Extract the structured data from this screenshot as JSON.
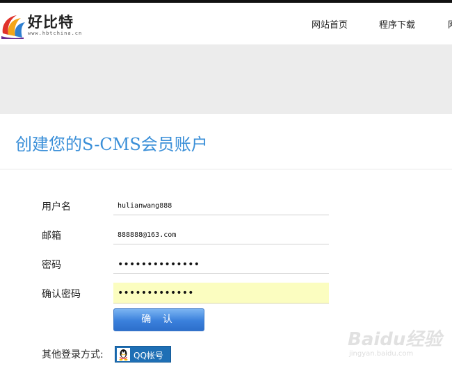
{
  "header": {
    "logo_title": "好比特",
    "logo_url": "www.hbtchina.cn",
    "nav": [
      "网站首页",
      "程序下载",
      "网"
    ]
  },
  "page": {
    "title": "创建您的S-CMS会员账户"
  },
  "form": {
    "username": {
      "label": "用户名",
      "value": "hulianwang888"
    },
    "email": {
      "label": "邮箱",
      "value": "888888@163.com"
    },
    "password": {
      "label": "密码",
      "value": "••••••••••••••"
    },
    "confirm_password": {
      "label": "确认密码",
      "value": "•••••••••••••"
    },
    "submit_label": "确 认",
    "other_login_label": "其他登录方式:",
    "qq_button_label": "QQ帐号"
  },
  "watermark": {
    "main": "Baidu经验",
    "sub": "jingyan.baidu.com"
  },
  "colors": {
    "title_blue": "#3a8fd8",
    "button_blue": "#3a80dc",
    "focused_field": "#fbfdc0",
    "qq_blue": "#1e6fb5",
    "banner_gray": "#ececec"
  },
  "icons": {
    "logo": "hbt-logo-icon",
    "qq": "qq-penguin-icon"
  }
}
